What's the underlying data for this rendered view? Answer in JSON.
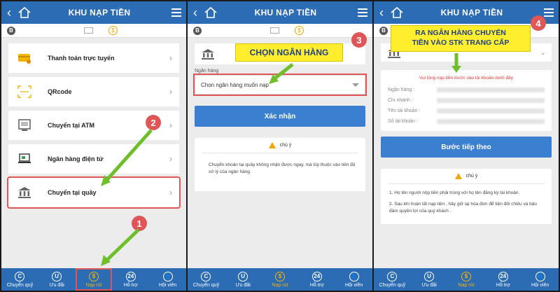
{
  "common": {
    "coin_letter": "B",
    "tabs": [
      {
        "icon": "C",
        "label": "Chuyển quỹ"
      },
      {
        "icon": "U",
        "label": "Ưu đãi"
      },
      {
        "icon": "$",
        "label": "Nạp rút"
      },
      {
        "icon": "24",
        "label": "Hỗ trợ"
      },
      {
        "icon": "👤",
        "label": "Hội viên"
      }
    ],
    "accent": "#2b6cb5",
    "active_tab_color": "#f5b400"
  },
  "panel1": {
    "title": "KHU NẠP TIỀN",
    "methods": [
      {
        "label": "Thanh toán trực tuyến"
      },
      {
        "label": "QRcode"
      },
      {
        "label": "Chuyển tại ATM"
      },
      {
        "label": "Ngân hàng điện tử"
      },
      {
        "label": "Chuyển tại quầy"
      }
    ],
    "badges": [
      "1",
      "2"
    ]
  },
  "panel2": {
    "title": "KHU NẠP TIỀN",
    "banner": "CHỌN NGÂN HÀNG",
    "badge": "3",
    "bank_label": "Ngân hàng",
    "bank_placeholder": "Chọn ngân hàng muốn nạp",
    "confirm": "Xác nhận",
    "note_title": "chú ý",
    "note_text": "Chuyển khoản tại quầy không nhận được ngay, mà tùy thuộc vào tiến độ xử lý của ngân hàng."
  },
  "panel3": {
    "title": "KHU NẠP TIỀN",
    "banner_line1": "RA NGÂN HÀNG CHUYỂN",
    "banner_line2": "TIỀN VÀO STK TRANG CẤP",
    "badge": "4",
    "warning": "Vui lòng nạp tiền trước vào tài khoản dưới đây",
    "fields": [
      {
        "key": "Ngân hàng :"
      },
      {
        "key": "Chi nhánh :"
      },
      {
        "key": "Tên tài khoản :"
      },
      {
        "key": "Số tài khoản :"
      }
    ],
    "next": "Bước tiếp theo",
    "note_title": "chú ý",
    "notes": [
      "1. Họ tên người nộp tiền phải trùng với họ tên đăng ký tài khoản.",
      "2. Sau khi hoàn tất nạp tiền , hãy giữ lại hóa đơn để tiện đối chiếu và bảo đảm quyền lợi của quý khách ."
    ]
  }
}
